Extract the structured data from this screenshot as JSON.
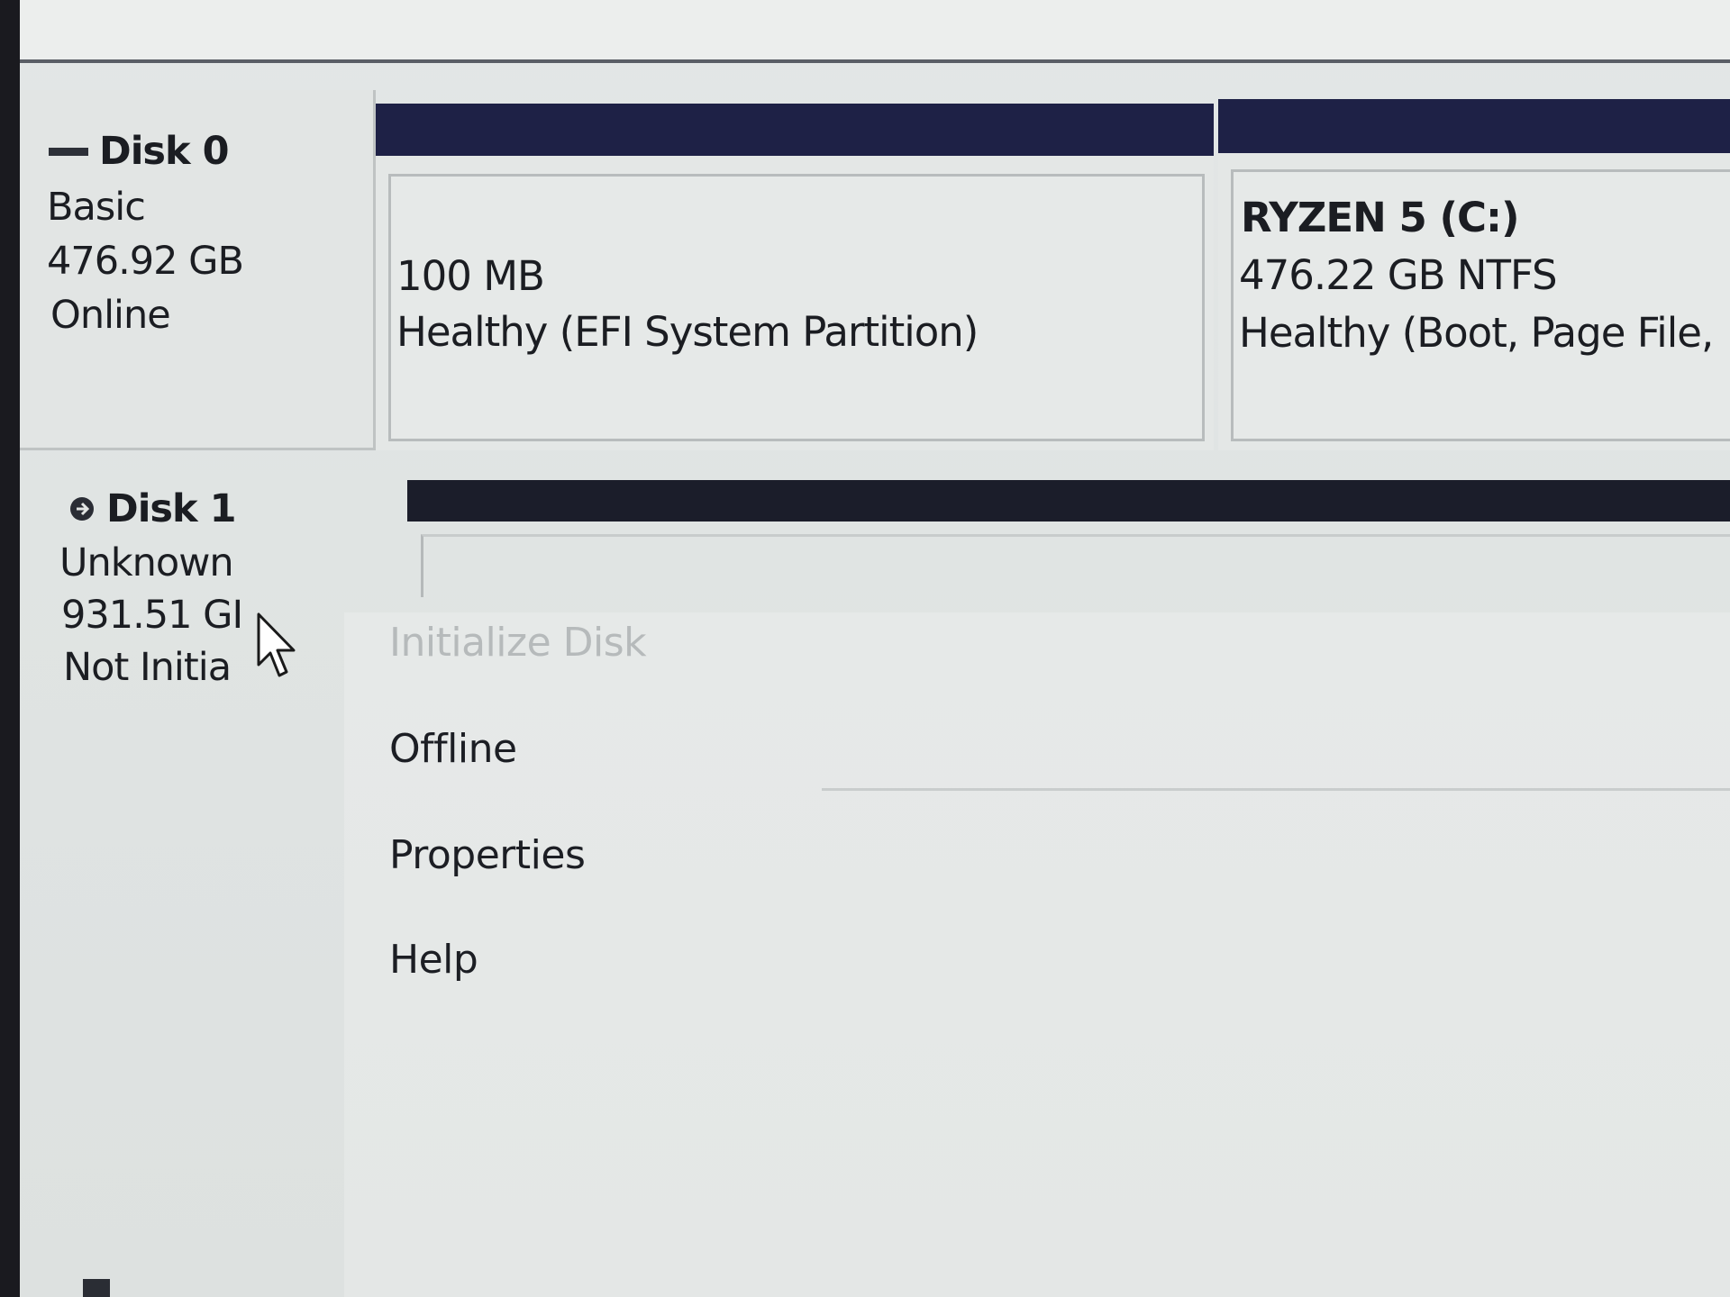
{
  "disks": {
    "disk0": {
      "name": "Disk 0",
      "type": "Basic",
      "size": "476.92 GB",
      "status": "Online",
      "icon": "disk-dash-icon"
    },
    "disk1": {
      "name": "Disk 1",
      "type": "Unknown",
      "size": "931.51 GI",
      "status": "Not Initia",
      "icon": "disk-circle-arrow-icon"
    }
  },
  "partitions": {
    "efi": {
      "size": "100 MB",
      "status": "Healthy (EFI System Partition)"
    },
    "c": {
      "name": "RYZEN 5  (C:)",
      "size": "476.22 GB NTFS",
      "status": "Healthy (Boot, Page File,"
    }
  },
  "context_menu": {
    "items": [
      {
        "label": "Initialize Disk",
        "enabled": false
      },
      {
        "label": "Offline",
        "enabled": true
      },
      {
        "label": "Properties",
        "enabled": true
      },
      {
        "label": "Help",
        "enabled": true
      }
    ]
  },
  "colors": {
    "partition_header": "#1e2146",
    "unallocated_header": "#1b1d2a",
    "window_bg": "#e2e5e4",
    "disabled_text": "#b6babb"
  },
  "icons": {
    "cursor": "mouse-pointer-icon"
  }
}
